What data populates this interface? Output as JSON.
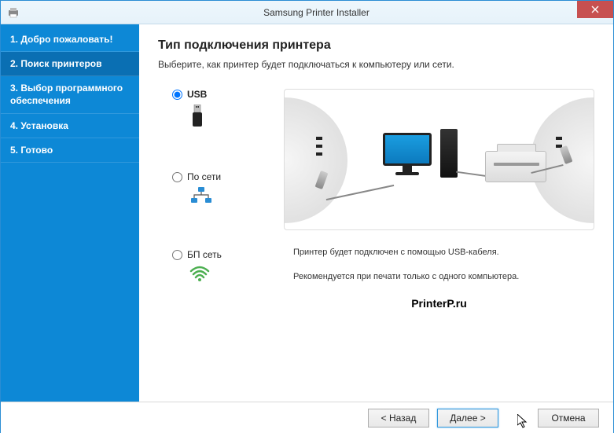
{
  "window": {
    "title": "Samsung Printer Installer"
  },
  "sidebar": {
    "items": [
      {
        "label": "1. Добро пожаловать!"
      },
      {
        "label": "2. Поиск принтеров"
      },
      {
        "label": "3. Выбор программного обеспечения"
      },
      {
        "label": "4. Установка"
      },
      {
        "label": "5. Готово"
      }
    ],
    "active_index": 1
  },
  "page": {
    "title": "Тип подключения принтера",
    "subtitle": "Выберите, как принтер будет подключаться к компьютеру или сети."
  },
  "options": {
    "usb": {
      "label": "USB",
      "selected": true
    },
    "network": {
      "label": "По сети",
      "selected": false
    },
    "wireless": {
      "label": "БП сеть",
      "selected": false
    }
  },
  "detail": {
    "line1": "Принтер будет подключен с помощью USB-кабеля.",
    "line2": "Рекомендуется при печати только с одного компьютера."
  },
  "watermark": "PrinterP.ru",
  "footer": {
    "back": "< Назад",
    "next": "Далее >",
    "cancel": "Отмена"
  }
}
